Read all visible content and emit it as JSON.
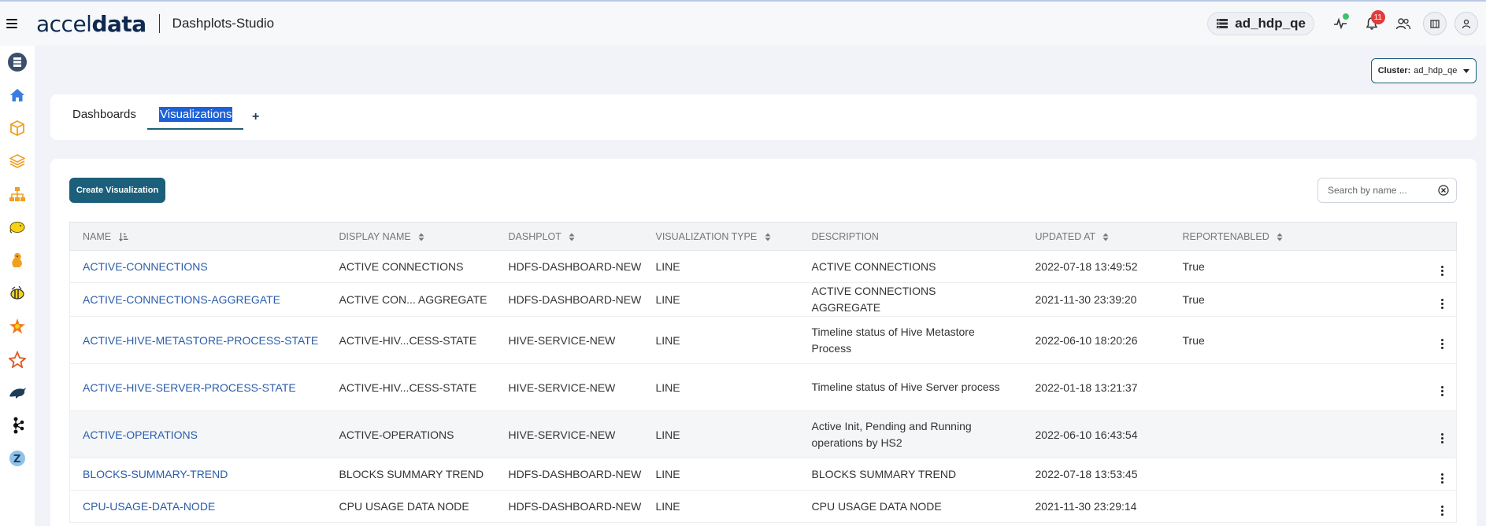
{
  "header": {
    "brand_light": "accel",
    "brand_bold": "data",
    "app_title": "Dashplots-Studio",
    "cluster_name": "ad_hdp_qe",
    "notification_count": "11"
  },
  "sidebar": {
    "items": [
      {
        "icon": "database-icon"
      },
      {
        "icon": "home-icon"
      },
      {
        "icon": "cube-icon"
      },
      {
        "icon": "layers-icon"
      },
      {
        "icon": "hierarchy-icon"
      },
      {
        "icon": "hadoop-elephant-icon"
      },
      {
        "icon": "squirrel-icon"
      },
      {
        "icon": "hive-bee-icon"
      },
      {
        "icon": "spark-star-icon"
      },
      {
        "icon": "cluster-star-icon"
      },
      {
        "icon": "dolphin-icon"
      },
      {
        "icon": "kafka-icon"
      },
      {
        "icon": "zookeeper-icon"
      }
    ]
  },
  "cluster_selector": {
    "label": "Cluster:",
    "value": "ad_hdp_qe"
  },
  "tabs": [
    {
      "label": "Dashboards",
      "active": false
    },
    {
      "label": "Visualizations",
      "active": true
    }
  ],
  "tab_add_label": "+",
  "toolbar": {
    "create_label": "Create Visualization",
    "search_placeholder": "Search by name ..."
  },
  "table": {
    "columns": [
      "NAME",
      "DISPLAY NAME",
      "DASHPLOT",
      "VISUALIZATION TYPE",
      "DESCRIPTION",
      "UPDATED AT",
      "REPORTENABLED"
    ],
    "rows": [
      {
        "name": "ACTIVE-CONNECTIONS",
        "display": "ACTIVE CONNECTIONS",
        "dashplot": "HDFS-DASHBOARD-NEW",
        "type": "LINE",
        "desc": "ACTIVE CONNECTIONS",
        "updated": "2022-07-18 13:49:52",
        "report": "True",
        "tall": false
      },
      {
        "name": "ACTIVE-CONNECTIONS-AGGREGATE",
        "display": "ACTIVE CON... AGGREGATE",
        "dashplot": "HDFS-DASHBOARD-NEW",
        "type": "LINE",
        "desc": "ACTIVE CONNECTIONS AGGREGATE",
        "updated": "2021-11-30 23:39:20",
        "report": "True",
        "tall": false
      },
      {
        "name": "ACTIVE-HIVE-METASTORE-PROCESS-STATE",
        "display": "ACTIVE-HIV...CESS-STATE",
        "dashplot": "HIVE-SERVICE-NEW",
        "type": "LINE",
        "desc": "Timeline status of Hive Metastore Process",
        "updated": "2022-06-10 18:20:26",
        "report": "True",
        "tall": true
      },
      {
        "name": "ACTIVE-HIVE-SERVER-PROCESS-STATE",
        "display": "ACTIVE-HIV...CESS-STATE",
        "dashplot": "HIVE-SERVICE-NEW",
        "type": "LINE",
        "desc": "Timeline status of Hive Server process",
        "updated": "2022-01-18 13:21:37",
        "report": "",
        "tall": true
      },
      {
        "name": "ACTIVE-OPERATIONS",
        "display": "ACTIVE-OPERATIONS",
        "dashplot": "HIVE-SERVICE-NEW",
        "type": "LINE",
        "desc": "Active Init, Pending and Running operations by HS2",
        "updated": "2022-06-10 16:43:54",
        "report": "",
        "tall": true,
        "hover": true
      },
      {
        "name": "BLOCKS-SUMMARY-TREND",
        "display": "BLOCKS SUMMARY TREND",
        "dashplot": "HDFS-DASHBOARD-NEW",
        "type": "LINE",
        "desc": "BLOCKS SUMMARY TREND",
        "updated": "2022-07-18 13:53:45",
        "report": "",
        "tall": false
      },
      {
        "name": "CPU-USAGE-DATA-NODE",
        "display": "CPU USAGE DATA NODE",
        "dashplot": "HDFS-DASHBOARD-NEW",
        "type": "LINE",
        "desc": "CPU USAGE DATA NODE",
        "updated": "2021-11-30 23:29:14",
        "report": "",
        "tall": false
      }
    ]
  },
  "colors": {
    "accent": "#1b5f7a",
    "link": "#2a5cab",
    "selection": "#1d61d8"
  }
}
